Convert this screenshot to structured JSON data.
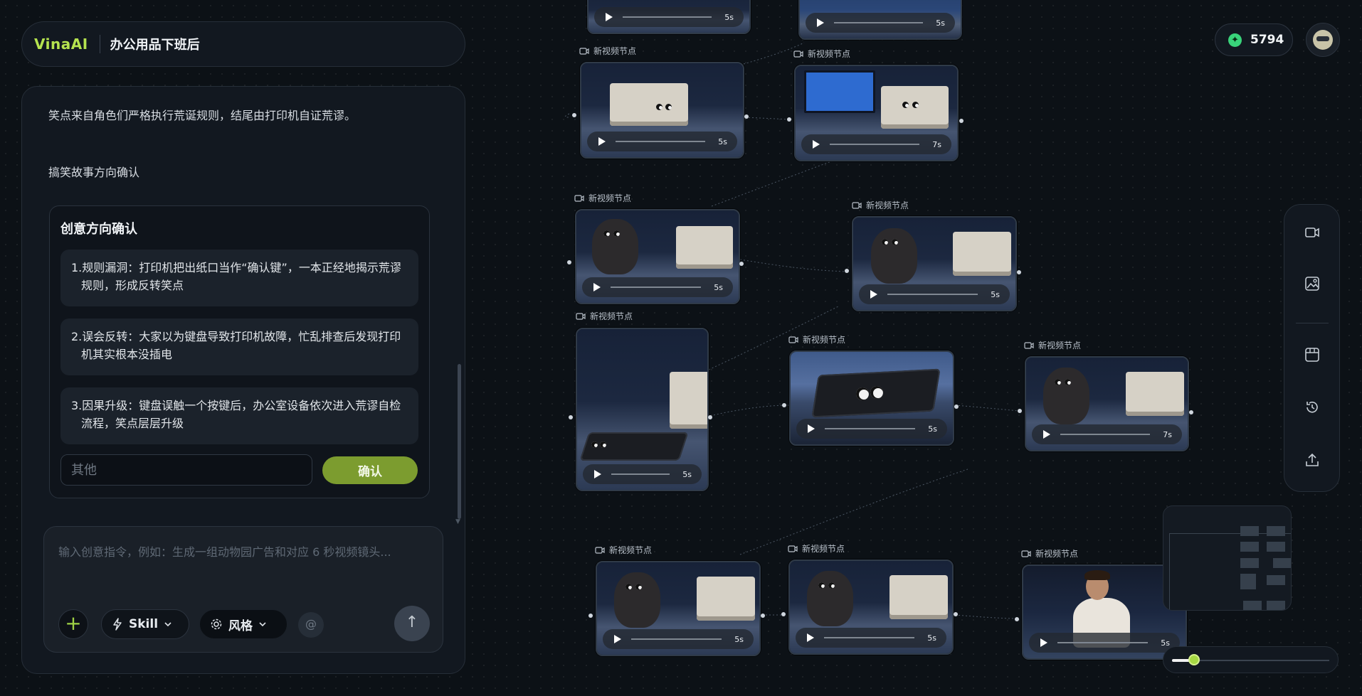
{
  "header": {
    "logo": "VinaAI",
    "project_title": "办公用品下班后"
  },
  "chat": {
    "message_1": "笑点来自角色们严格执行荒诞规则，结尾由打印机自证荒谬。",
    "message_2": "搞笑故事方向确认",
    "card": {
      "title": "创意方向确认",
      "options": [
        "1.规则漏洞：打印机把出纸口当作“确认键”，一本正经地揭示荒谬规则，形成反转笑点",
        "2.误会反转：大家以为键盘导致打印机故障，忙乱排查后发现打印机其实根本没插电",
        "3.因果升级：键盘误触一个按键后，办公室设备依次进入荒谬自检流程，笑点层层升级"
      ],
      "other_placeholder": "其他",
      "confirm_label": "确认"
    },
    "composer": {
      "placeholder": "输入创意指令，例如：生成一组动物园广告和对应 6 秒视频镜头...",
      "skill_label": "Skill",
      "style_label": "风格"
    }
  },
  "canvas": {
    "node_label": "新视频节点",
    "nodes": [
      {
        "duration": "5s",
        "scene": "top-a"
      },
      {
        "duration": "5s",
        "scene": "top-b"
      },
      {
        "duration": "5s",
        "scene": "printer-desk"
      },
      {
        "duration": "7s",
        "scene": "monitor-printer"
      },
      {
        "duration": "5s",
        "scene": "rock-printer"
      },
      {
        "duration": "5s",
        "scene": "rock-printer"
      },
      {
        "duration": "5s",
        "scene": "tall-keyboard"
      },
      {
        "duration": "5s",
        "scene": "keyboard-eyes"
      },
      {
        "duration": "7s",
        "scene": "rock-printer"
      },
      {
        "duration": "5s",
        "scene": "rock-printer"
      },
      {
        "duration": "5s",
        "scene": "rock-printer"
      },
      {
        "duration": "5s",
        "scene": "man-desk"
      }
    ]
  },
  "account": {
    "credits": "5794"
  },
  "toolbar": {
    "icons": [
      "video-icon",
      "image-icon",
      "storyboard-icon",
      "history-icon",
      "upload-icon"
    ]
  },
  "zoom": {
    "level": 0.14
  },
  "colors": {
    "accent": "#a6d843",
    "brand": "#b5e34f",
    "confirm": "#7c9c2f"
  }
}
